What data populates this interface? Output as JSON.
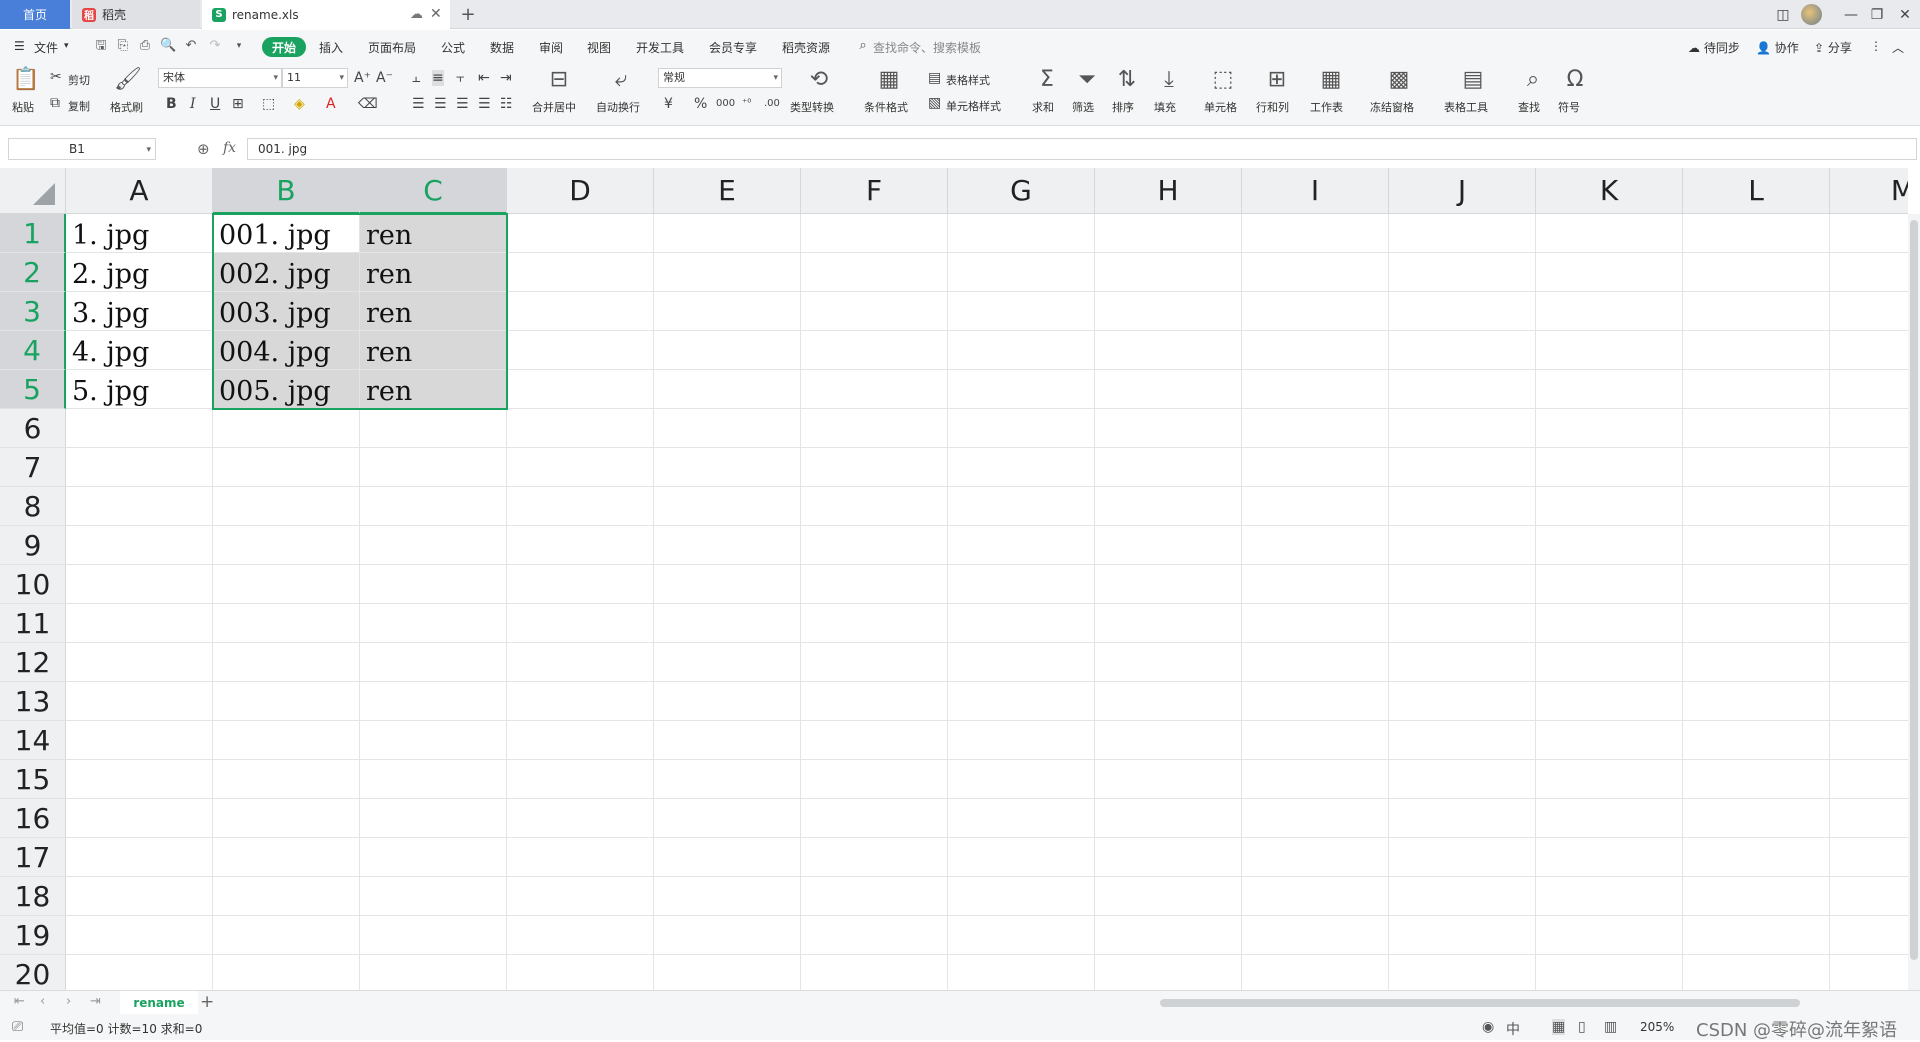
{
  "tabs": {
    "home": "首页",
    "docer": "稻壳",
    "file": "rename.xls"
  },
  "menu": {
    "file": "文件",
    "start": "开始",
    "items": [
      "插入",
      "页面布局",
      "公式",
      "数据",
      "审阅",
      "视图",
      "开发工具",
      "会员专享",
      "稻壳资源"
    ],
    "search_placeholder": "查找命令、搜索模板",
    "sync": "待同步",
    "collab": "协作",
    "share": "分享"
  },
  "ribbon": {
    "paste": "粘贴",
    "cut": "剪切",
    "copy": "复制",
    "format_painter": "格式刷",
    "font_name": "宋体",
    "font_size": "11",
    "merge_center": "合并居中",
    "wrap_text": "自动换行",
    "number_format": "常规",
    "type_convert": "类型转换",
    "cond_format": "条件格式",
    "table_style": "表格样式",
    "cell_style": "单元格样式",
    "sum": "求和",
    "filter": "筛选",
    "sort": "排序",
    "fill": "填充",
    "cell": "单元格",
    "row_col": "行和列",
    "worksheet": "工作表",
    "freeze": "冻结窗格",
    "table_tools": "表格工具",
    "find": "查找",
    "symbol": "符号"
  },
  "formula_bar": {
    "name_box": "B1",
    "fx": "fx",
    "content": "001. jpg"
  },
  "sheet": {
    "columns": [
      "A",
      "B",
      "C",
      "D",
      "E",
      "F",
      "G",
      "H",
      "I",
      "J",
      "K",
      "L",
      "M"
    ],
    "rows": [
      "1",
      "2",
      "3",
      "4",
      "5",
      "6",
      "7",
      "8",
      "9",
      "10",
      "11",
      "12",
      "13",
      "14",
      "15",
      "16",
      "17",
      "18",
      "19",
      "20"
    ],
    "cells": [
      [
        "1. jpg",
        "001. jpg",
        "ren"
      ],
      [
        "2. jpg",
        "002. jpg",
        "ren"
      ],
      [
        "3. jpg",
        "003. jpg",
        "ren"
      ],
      [
        "4. jpg",
        "004. jpg",
        "ren"
      ],
      [
        "5. jpg",
        "005. jpg",
        "ren"
      ]
    ],
    "selected_columns": [
      "B",
      "C"
    ],
    "selected_rows": [
      "1",
      "2",
      "3",
      "4",
      "5"
    ]
  },
  "sheet_tabs": {
    "active": "rename"
  },
  "status": {
    "summary": "平均值=0  计数=10  求和=0",
    "zoom": "205%",
    "watermark": "CSDN @零碎@流年絮语"
  },
  "colors": {
    "accent": "#1aa260",
    "home_tab": "#4a7fd9",
    "selection_fill": "#d8d8d8"
  }
}
